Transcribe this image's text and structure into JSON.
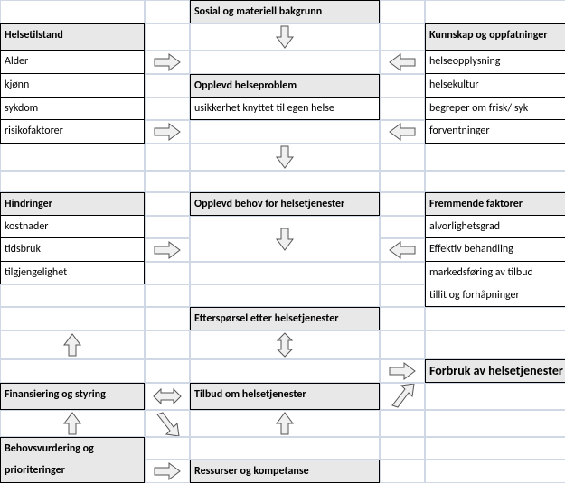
{
  "col1": {
    "helsetilstand": {
      "title": "Helsetilstand",
      "items": [
        "Alder",
        "kjønn",
        "sykdom",
        "risikofaktorer"
      ]
    },
    "hindringer": {
      "title": "Hindringer",
      "items": [
        "kostnader",
        "tidsbruk",
        "tilgjengelighet"
      ]
    },
    "finansiering": "Finansiering og styring",
    "behovsvurdering": {
      "line1": "Behovsvurdering og",
      "line2": "prioriteringer"
    }
  },
  "col3": {
    "sosial": "Sosial og materiell bakgrunn",
    "opplevdHelseproblem": {
      "title": "Opplevd helseproblem",
      "sub": "usikkerhet knyttet til egen helse"
    },
    "opplevdBehov": "Opplevd behov for helsetjenester",
    "ettersporsel": "Etterspørsel etter helsetjenester",
    "tilbud": "Tilbud om helsetjenester",
    "ressurser": "Ressurser og kompetanse"
  },
  "col5": {
    "kunnskap": {
      "title": "Kunnskap og oppfatninger",
      "items": [
        "helseopplysning",
        "helsekultur",
        "begreper om frisk/ syk",
        "forventninger"
      ]
    },
    "fremmende": {
      "title": "Fremmende faktorer",
      "items": [
        "alvorlighetsgrad",
        "Effektiv behandling",
        "markedsføring av tilbud",
        "tillit og forhåpninger"
      ]
    },
    "forbruk": "Forbruk av helsetjenester"
  }
}
